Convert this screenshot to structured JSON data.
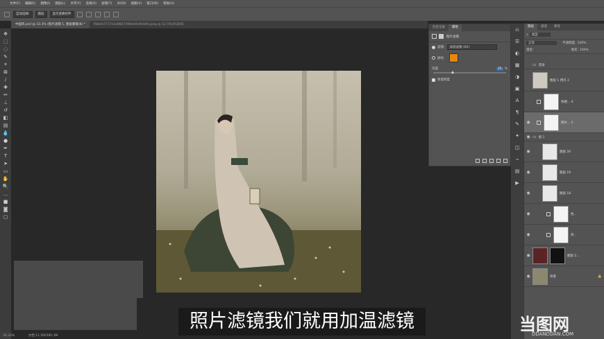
{
  "menubar": {
    "items": [
      "文件(F)",
      "编辑(E)",
      "图像(I)",
      "图层(L)",
      "文字(Y)",
      "选择(S)",
      "滤镜(T)",
      "3D(D)",
      "视图(V)",
      "窗口(W)",
      "帮助(H)"
    ]
  },
  "options": {
    "autoselect": "自动选择:",
    "target": "图层",
    "transform": "显示变换控件"
  },
  "document_tabs": [
    {
      "label": "中国风.psd @ 33.3% (照片滤镜 1, 图层蒙版/8) *"
    },
    {
      "label": "9bbeb7717e1e88b739b0d4a9d3dd.jpeg @ 12.5%(RGB/8)"
    }
  ],
  "subtitle": "照片滤镜我们就用加温滤镜",
  "status": {
    "zoom": "33.33%",
    "doc": "文档:11.5M/390.3M"
  },
  "properties": {
    "tabs": [
      "历史记录",
      "属性"
    ],
    "title": "照片滤镜",
    "filter_label": "滤镜:",
    "filter_value": "加温滤镜 (85)",
    "color_label": "颜色:",
    "color_swatch": "#e0890f",
    "density_label": "浓度:",
    "density_value": "25",
    "density_unit": "%",
    "preserve_label": "保留明度"
  },
  "layers": {
    "tabs": [
      "图层",
      "通道",
      "路径"
    ],
    "kind": "类型",
    "blend": "正常",
    "opacity_label": "不透明度:",
    "opacity": "100%",
    "lock_label": "锁定:",
    "fill_label": "填充:",
    "fill": "100%",
    "items": [
      {
        "name": "花朵"
      },
      {
        "name": "图层 1 拷贝 2"
      },
      {
        "name": "色相... 4"
      },
      {
        "name": "照片... 2"
      },
      {
        "name": "组 1"
      },
      {
        "name": "图层 20"
      },
      {
        "name": "图层 19"
      },
      {
        "name": "图层 18"
      },
      {
        "name": "色..."
      },
      {
        "name": "亮..."
      },
      {
        "name": "图层 2..."
      },
      {
        "name": "背景"
      }
    ]
  },
  "watermark": {
    "text_cn": "当图网",
    "text_en": "DDANDDAN.COM"
  }
}
